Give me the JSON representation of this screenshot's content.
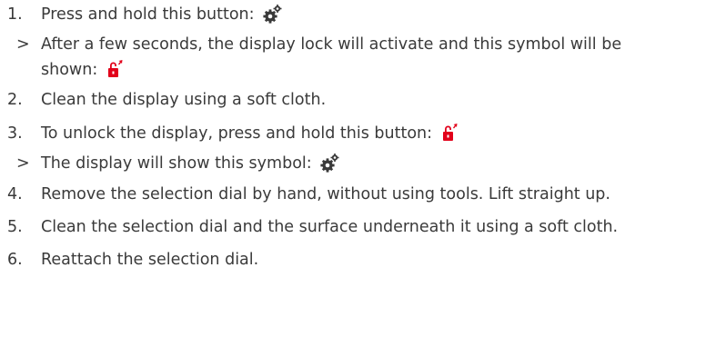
{
  "steps": [
    {
      "num": "1.",
      "text": "Press and hold this button:",
      "icon": "gear-icon"
    },
    {
      "marker": ">",
      "text": "After a few seconds, the display lock will activate and this symbol will be",
      "text2": "shown:",
      "icon": "lock-icon"
    },
    {
      "num": "2.",
      "text": "Clean the display using a soft cloth."
    },
    {
      "num": "3.",
      "text": "To unlock the display, press and hold this button:",
      "icon": "lock-icon"
    },
    {
      "marker": ">",
      "text": "The display will show this symbol:",
      "icon": "gear-icon"
    },
    {
      "num": "4.",
      "text": "Remove the selection dial by hand, without using tools. Lift straight up."
    },
    {
      "num": "5.",
      "text": "Clean the selection dial and the surface underneath it using a soft cloth."
    },
    {
      "num": "6.",
      "text": "Reattach the selection dial."
    }
  ],
  "colors": {
    "text": "#3a3a3a",
    "lock": "#e2001a",
    "gear": "#3a3a3a"
  }
}
